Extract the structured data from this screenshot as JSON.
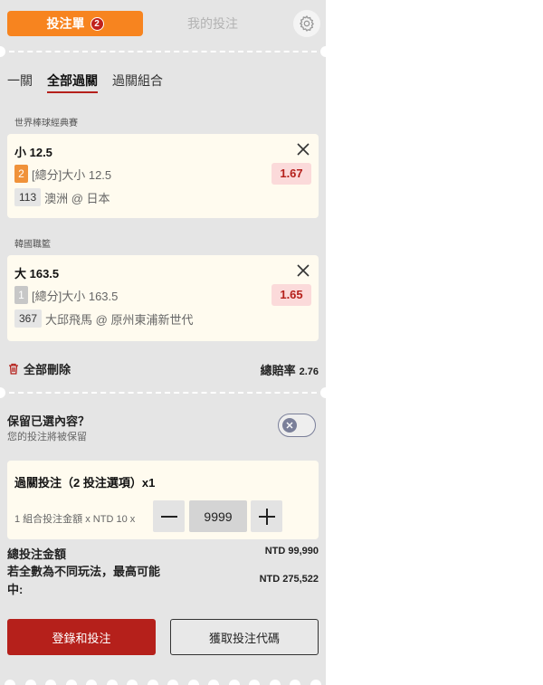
{
  "header": {
    "betslip_label": "投注單",
    "betslip_count": "2",
    "mybets_label": "我的投注",
    "settings_icon": "gear-icon"
  },
  "bet_type_tabs": [
    {
      "label": "一關",
      "active": false
    },
    {
      "label": "全部過關",
      "active": true
    },
    {
      "label": "過關組合",
      "active": false
    }
  ],
  "selections": [
    {
      "league": "世界棒球經典賽",
      "selection": "小 12.5",
      "number": "2",
      "market": "[總分]大小 12.5",
      "code": "113",
      "match": "澳洲 @ 日本",
      "odds": "1.67"
    },
    {
      "league": "韓國職籃",
      "selection": "大 163.5",
      "number": "1",
      "market": "[總分]大小 163.5",
      "code": "367",
      "match": "大邱飛馬 @ 原州東浦新世代",
      "odds": "1.65"
    }
  ],
  "summary": {
    "delete_all": "全部刪除",
    "total_odds_label": "總賠率",
    "total_odds_value": "2.76"
  },
  "retain": {
    "title": "保留已選內容？",
    "subtitle": "您的投注將被保留"
  },
  "multi_bet": {
    "title": "過關投注（2 投注選項）x1",
    "desc": "1 組合投注金額 x NTD 10 x",
    "stake_value": "9999"
  },
  "totals": {
    "stake_label": "總投注金額",
    "stake_value": "NTD 99,990",
    "max_win_label": "若全數為不同玩法，最高可能中:",
    "max_win_value": "NTD 275,522"
  },
  "buttons": {
    "login_bet": "登錄和投注",
    "get_code": "獲取投注代碼"
  },
  "colors": {
    "accent_orange": "#f7841f",
    "primary_red": "#b5201b",
    "card_bg": "#fffbef",
    "panel_bg": "#e5e5e5"
  }
}
